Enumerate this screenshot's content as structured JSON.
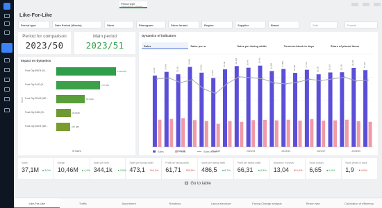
{
  "header": {
    "title": "Like-For-Like",
    "period_tab": {
      "label": "Period type",
      "sub": "Date Period (Weeks)"
    }
  },
  "filters": [
    {
      "label": "Period type"
    },
    {
      "label": "Date Period (Weeks)"
    },
    {
      "label": "Store"
    },
    {
      "label": "Planogram"
    },
    {
      "label": "Store format"
    },
    {
      "label": "Region"
    },
    {
      "label": "Supplier"
    },
    {
      "label": "Brand"
    }
  ],
  "search": {
    "placeholder_a": "Sale",
    "placeholder_b": "Format"
  },
  "periods": {
    "comparison": {
      "label": "Period for comparison",
      "value": "2023/50"
    },
    "main": {
      "label": "Main period",
      "value": "2023/51"
    }
  },
  "impact": {
    "title": "Impact on dynamics",
    "axis_label": "$ Sales",
    "y_axis_label": "Store",
    "items": [
      {
        "label": "Food City 69674 (W...",
        "value": "1 084 857",
        "frac": 0.86,
        "color": "#2e9e4a"
      },
      {
        "label": "Food City 3442 (N...",
        "value": "797 456",
        "frac": 0.63,
        "color": "#3aa04a"
      },
      {
        "label": "Food City 35149 (WE...",
        "value": "513 040",
        "frac": 0.41,
        "color": "#5a9e3a"
      },
      {
        "label": "Food City 3481 (W...",
        "value": "263 845",
        "frac": 0.21,
        "color": "#6f9a33"
      },
      {
        "label": "Food City 40874 (WE...",
        "value": "247 485",
        "frac": 0.2,
        "color": "#7a9c30"
      }
    ]
  },
  "dynamics": {
    "title": "Dynamics of indicators",
    "tabs": [
      {
        "label": "Sales",
        "active": true
      },
      {
        "label": "Sales per sr",
        "active": false
      },
      {
        "label": "Sales per facing width",
        "active": false
      },
      {
        "label": "Turnover/stock in days",
        "active": false
      },
      {
        "label": "Share of placed items",
        "active": false
      }
    ],
    "legend": {
      "sales": "Sales",
      "profit": "Profit",
      "sales_py": "Sales of prev."
    }
  },
  "chart_data": {
    "type": "bar",
    "categories": [
      "2023/33",
      "2023/34",
      "2023/35",
      "2023/36",
      "2023/37",
      "2023/38",
      "2023/39",
      "2023/40",
      "2023/41",
      "2023/42",
      "2023/43",
      "2023/44",
      "2023/45",
      "2023/46",
      "2023/47",
      "2023/48",
      "2023/49",
      "2023/50",
      "2023/51"
    ],
    "x_tick_labels": [
      "2023/35",
      "2023/38",
      "2023/41",
      "2023/44",
      "2023/47",
      "2023/50"
    ],
    "series": [
      {
        "name": "Sales",
        "type": "bar",
        "color": "#5b4fd8",
        "values": [
          34.6,
          36.4,
          35.2,
          38.8,
          36.0,
          33.4,
          37.6,
          39.2,
          38.4,
          39.4,
          36.8,
          37.8,
          35.9,
          37.4,
          35.2,
          36.1,
          36.2,
          38.3,
          37.2
        ]
      },
      {
        "name": "Profit",
        "type": "bar",
        "color": "#ef9aa6",
        "values": [
          13.2,
          13.6,
          14.0,
          13.0,
          12.6,
          11.2,
          12.6,
          12.2,
          13.0,
          13.1,
          12.9,
          13.2,
          12.8,
          13.5,
          12.8,
          12.9,
          13.2,
          12.5,
          12.2
        ]
      },
      {
        "name": "Sales of prev.",
        "type": "line",
        "color": "#a9a9b4",
        "values": [
          33.0,
          33.4,
          31.2,
          32.6,
          28.0,
          26.0,
          30.8,
          34.0,
          33.6,
          33.0,
          31.0,
          30.6,
          31.4,
          32.8,
          32.2,
          33.0,
          33.8,
          32.0,
          32.4
        ]
      }
    ],
    "bar_labels": [
      "34,6M",
      "36,4M",
      "35,2M",
      "38,8M",
      "36,0M",
      "33,4M",
      "37,6M",
      "39,2M",
      "38,4M",
      "39,4M",
      "36,8M",
      "37,8M",
      "35,9M",
      "37,4M",
      "35,2M",
      "36,1M",
      "36,2M",
      "38,3M",
      "37,2M"
    ],
    "ylim": [
      0,
      45
    ],
    "grid": true,
    "legend_position": "bottom-left"
  },
  "kpis": [
    {
      "label": "Sales",
      "value": "37,1M",
      "delta": "3,0%",
      "dir": "up"
    },
    {
      "label": "Margin",
      "value": "10,46M",
      "delta": "4,4%",
      "dir": "up"
    },
    {
      "label": "Sales per item",
      "value": "344,1k",
      "delta": "3,5%",
      "dir": "up"
    },
    {
      "label": "Sales per facing width",
      "value": "473,1",
      "delta": "6,1%",
      "dir": "down"
    },
    {
      "label": "Profit per facing width",
      "value": "61,71",
      "delta": "5,8%",
      "dir": "down"
    },
    {
      "label": "Sales per facing width",
      "value": "486,5",
      "delta": "8,7%",
      "dir": "up"
    },
    {
      "label": "Profit per facing width",
      "value": "66,31",
      "delta": "8,8%",
      "dir": "up"
    },
    {
      "label": "Stockless Turnover",
      "value": "13,04",
      "delta": "0,9%",
      "dir": "down"
    },
    {
      "label": "Stock (value)",
      "value": "6,65",
      "delta": "0,9%",
      "dir": "up"
    },
    {
      "label": "Stock (level) in days",
      "value": "1,9",
      "delta": "4,0%",
      "dir": "down"
    }
  ],
  "goto_label": "Go to table",
  "bottom_tabs": [
    {
      "label": "Like-For-Like",
      "active": true
    },
    {
      "label": "Traffic",
      "active": false
    },
    {
      "label": "Assortment",
      "active": false
    },
    {
      "label": "Rotations",
      "active": false
    },
    {
      "label": "Layout structure",
      "active": false
    },
    {
      "label": "Facing Change analysis",
      "active": false
    },
    {
      "label": "Return rate",
      "active": false
    },
    {
      "label": "Calculation of efficiency",
      "active": false
    }
  ]
}
